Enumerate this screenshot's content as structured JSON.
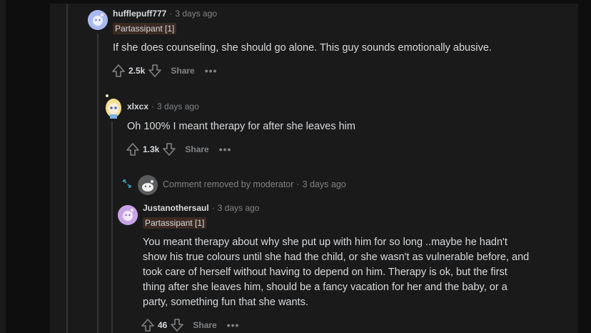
{
  "comments": [
    {
      "username": "hufflepuff777",
      "time": "3 days ago",
      "flair": "Partassipant [1]",
      "body": "If she does counseling, she should go alone. This guy sounds emotionally abusive.",
      "votes": "2.5k",
      "share_label": "Share",
      "more_label": "•••"
    },
    {
      "username": "xlxcx",
      "time": "3 days ago",
      "body": "Oh 100% I meant therapy for after she leaves him",
      "votes": "1.3k",
      "share_label": "Share",
      "more_label": "•••"
    },
    {
      "removed_text": "Comment removed by moderator",
      "time": "3 days ago"
    },
    {
      "username": "Justanothersaul",
      "time": "3 days ago",
      "flair": "Partassipant [1]",
      "body_lines": [
        "You meant therapy about why she put up with him for so long ..maybe he hadn't",
        "show his true colours until she had the child, or she wasn't as vulnerable before, and",
        "took care of herself without having to depend on him. Therapy is ok, but the first",
        "thing after she leaves him, should be a fancy vacation for her and the baby, or a",
        "party, something fun that she wants."
      ],
      "votes": "46",
      "share_label": "Share",
      "more_label": "•••"
    }
  ],
  "separator": "·",
  "colors": {
    "background": "#1a1a1b",
    "text": "#d7dadc",
    "meta": "#818384",
    "flair_bg": "#3a2a22",
    "thread_line": "#343536"
  }
}
